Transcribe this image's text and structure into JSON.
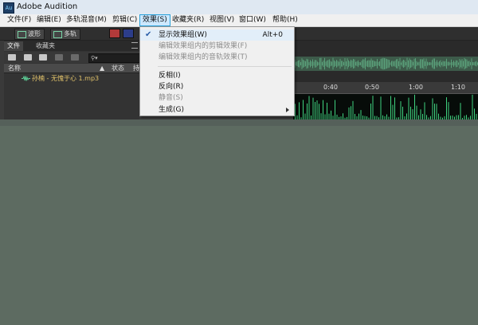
{
  "window": {
    "title": "Adobe Audition",
    "icon_label": "Au"
  },
  "menubar": {
    "items": [
      {
        "label": "文件(F)"
      },
      {
        "label": "编辑(E)"
      },
      {
        "label": "多轨混音(M)"
      },
      {
        "label": "剪辑(C)"
      },
      {
        "label": "效果(S)",
        "active": true
      },
      {
        "label": "收藏夹(R)"
      },
      {
        "label": "视图(V)"
      },
      {
        "label": "窗口(W)"
      },
      {
        "label": "帮助(H)"
      }
    ]
  },
  "toolbar": {
    "waveform_label": "波形",
    "multitrack_label": "多轨"
  },
  "files_panel": {
    "tabs": [
      {
        "label": "文件"
      },
      {
        "label": "收藏夹"
      }
    ],
    "search_placeholder": "",
    "columns": {
      "name": "名称",
      "status": "状态",
      "extra": "持"
    },
    "files": [
      {
        "name": "孙楠 - 无愧于心 1.mp3"
      }
    ]
  },
  "editor": {
    "ruler_ticks": [
      "0:40",
      "0:50",
      "1:00",
      "1:10"
    ],
    "colors": {
      "waveform": "#3fd27f",
      "overview": "#5aa07a"
    }
  },
  "effects_menu": {
    "items": [
      {
        "label": "显示效果组(W)",
        "shortcut": "Alt+0",
        "checked": true,
        "disabled": false
      },
      {
        "label": "编辑效果组内的剪辑效果(F)",
        "shortcut": "",
        "disabled": true
      },
      {
        "label": "编辑效果组内的音轨效果(T)",
        "shortcut": "",
        "disabled": true
      },
      {
        "label": "反相(I)",
        "shortcut": "",
        "disabled": false
      },
      {
        "label": "反向(R)",
        "shortcut": "",
        "disabled": false
      },
      {
        "label": "静音(S)",
        "shortcut": "",
        "disabled": true
      },
      {
        "label": "生成(G)",
        "shortcut": "",
        "disabled": false,
        "submenu": true
      }
    ]
  }
}
